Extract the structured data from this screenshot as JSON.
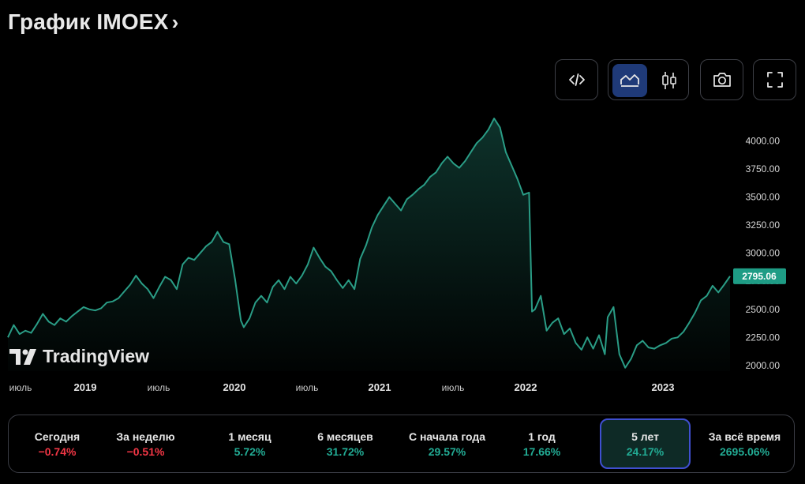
{
  "header": {
    "title": "График IMOEX",
    "chevron": "›"
  },
  "toolbar": {
    "buttons": [
      {
        "id": "embed",
        "icon": "code-icon"
      },
      {
        "id": "area",
        "icon": "area-chart-icon",
        "active": true
      },
      {
        "id": "candles",
        "icon": "candlestick-icon"
      },
      {
        "id": "snapshot",
        "icon": "camera-icon"
      },
      {
        "id": "fullscreen",
        "icon": "fullscreen-icon"
      }
    ],
    "active_color": "#1f3a78"
  },
  "watermark": {
    "text": "TradingView"
  },
  "chart_data": {
    "type": "area",
    "x_ticks": [
      "июль",
      "2019",
      "июль",
      "2020",
      "июль",
      "2021",
      "июль",
      "2022",
      "2023"
    ],
    "y_ticks": [
      "2000.00",
      "2250.00",
      "2500.00",
      "2750.00",
      "3000.00",
      "3250.00",
      "3500.00",
      "3750.00",
      "4000.00"
    ],
    "ylim": [
      1950,
      4200
    ],
    "last_value_label": "2795.06",
    "line_color": "#2a9d86",
    "series": [
      {
        "points": [
          [
            0,
            2250
          ],
          [
            0.2,
            2360
          ],
          [
            0.4,
            2280
          ],
          [
            0.6,
            2310
          ],
          [
            0.8,
            2290
          ],
          [
            1.0,
            2370
          ],
          [
            1.2,
            2460
          ],
          [
            1.4,
            2390
          ],
          [
            1.6,
            2360
          ],
          [
            1.8,
            2420
          ],
          [
            2.0,
            2390
          ],
          [
            2.2,
            2440
          ],
          [
            2.4,
            2480
          ],
          [
            2.6,
            2520
          ],
          [
            2.8,
            2500
          ],
          [
            3.0,
            2490
          ],
          [
            3.2,
            2510
          ],
          [
            3.4,
            2560
          ],
          [
            3.6,
            2570
          ],
          [
            3.8,
            2600
          ],
          [
            4.0,
            2660
          ],
          [
            4.2,
            2720
          ],
          [
            4.4,
            2800
          ],
          [
            4.6,
            2730
          ],
          [
            4.8,
            2680
          ],
          [
            5.0,
            2600
          ],
          [
            5.2,
            2700
          ],
          [
            5.4,
            2790
          ],
          [
            5.6,
            2760
          ],
          [
            5.8,
            2680
          ],
          [
            6.0,
            2900
          ],
          [
            6.2,
            2960
          ],
          [
            6.4,
            2940
          ],
          [
            6.6,
            3000
          ],
          [
            6.8,
            3060
          ],
          [
            7.0,
            3100
          ],
          [
            7.2,
            3190
          ],
          [
            7.4,
            3100
          ],
          [
            7.6,
            3080
          ],
          [
            7.8,
            2770
          ],
          [
            8.0,
            2400
          ],
          [
            8.1,
            2340
          ],
          [
            8.3,
            2420
          ],
          [
            8.5,
            2560
          ],
          [
            8.7,
            2620
          ],
          [
            8.9,
            2560
          ],
          [
            9.1,
            2700
          ],
          [
            9.3,
            2760
          ],
          [
            9.5,
            2680
          ],
          [
            9.7,
            2790
          ],
          [
            9.9,
            2730
          ],
          [
            10.1,
            2800
          ],
          [
            10.3,
            2900
          ],
          [
            10.5,
            3050
          ],
          [
            10.7,
            2960
          ],
          [
            10.9,
            2880
          ],
          [
            11.1,
            2840
          ],
          [
            11.3,
            2760
          ],
          [
            11.5,
            2690
          ],
          [
            11.7,
            2760
          ],
          [
            11.9,
            2680
          ],
          [
            12.1,
            2950
          ],
          [
            12.3,
            3070
          ],
          [
            12.5,
            3230
          ],
          [
            12.7,
            3340
          ],
          [
            12.9,
            3420
          ],
          [
            13.1,
            3500
          ],
          [
            13.3,
            3440
          ],
          [
            13.5,
            3380
          ],
          [
            13.7,
            3480
          ],
          [
            13.9,
            3520
          ],
          [
            14.1,
            3570
          ],
          [
            14.3,
            3610
          ],
          [
            14.5,
            3680
          ],
          [
            14.7,
            3720
          ],
          [
            14.9,
            3800
          ],
          [
            15.1,
            3860
          ],
          [
            15.3,
            3800
          ],
          [
            15.5,
            3760
          ],
          [
            15.7,
            3820
          ],
          [
            15.9,
            3900
          ],
          [
            16.1,
            3980
          ],
          [
            16.3,
            4030
          ],
          [
            16.5,
            4100
          ],
          [
            16.7,
            4200
          ],
          [
            16.9,
            4120
          ],
          [
            17.1,
            3900
          ],
          [
            17.3,
            3780
          ],
          [
            17.5,
            3660
          ],
          [
            17.7,
            3520
          ],
          [
            17.9,
            3540
          ],
          [
            18.0,
            2480
          ],
          [
            18.1,
            2500
          ],
          [
            18.3,
            2620
          ],
          [
            18.5,
            2310
          ],
          [
            18.7,
            2380
          ],
          [
            18.9,
            2420
          ],
          [
            19.1,
            2280
          ],
          [
            19.3,
            2330
          ],
          [
            19.5,
            2200
          ],
          [
            19.7,
            2140
          ],
          [
            19.9,
            2250
          ],
          [
            20.1,
            2150
          ],
          [
            20.3,
            2270
          ],
          [
            20.5,
            2100
          ],
          [
            20.6,
            2430
          ],
          [
            20.8,
            2520
          ],
          [
            21.0,
            2100
          ],
          [
            21.2,
            1980
          ],
          [
            21.4,
            2060
          ],
          [
            21.6,
            2180
          ],
          [
            21.8,
            2220
          ],
          [
            22.0,
            2160
          ],
          [
            22.2,
            2150
          ],
          [
            22.4,
            2180
          ],
          [
            22.6,
            2200
          ],
          [
            22.8,
            2240
          ],
          [
            23.0,
            2250
          ],
          [
            23.2,
            2300
          ],
          [
            23.4,
            2380
          ],
          [
            23.6,
            2470
          ],
          [
            23.8,
            2580
          ],
          [
            24.0,
            2620
          ],
          [
            24.2,
            2710
          ],
          [
            24.4,
            2650
          ],
          [
            24.6,
            2720
          ],
          [
            24.8,
            2795
          ]
        ]
      }
    ]
  },
  "stats": [
    {
      "label": "Сегодня",
      "value": "−0.74%",
      "color": "#f23645"
    },
    {
      "label": "За неделю",
      "value": "−0.51%",
      "color": "#f23645"
    },
    {
      "label": "1 месяц",
      "value": "5.72%",
      "color": "#22ab94"
    },
    {
      "label": "6 месяцев",
      "value": "31.72%",
      "color": "#22ab94"
    },
    {
      "label": "С начала года",
      "value": "29.57%",
      "color": "#22ab94"
    },
    {
      "label": "1 год",
      "value": "17.66%",
      "color": "#22ab94"
    },
    {
      "label": "5 лет",
      "value": "24.17%",
      "color": "#22ab94",
      "active": true
    },
    {
      "label": "За всё время",
      "value": "2695.06%",
      "color": "#22ab94"
    }
  ]
}
